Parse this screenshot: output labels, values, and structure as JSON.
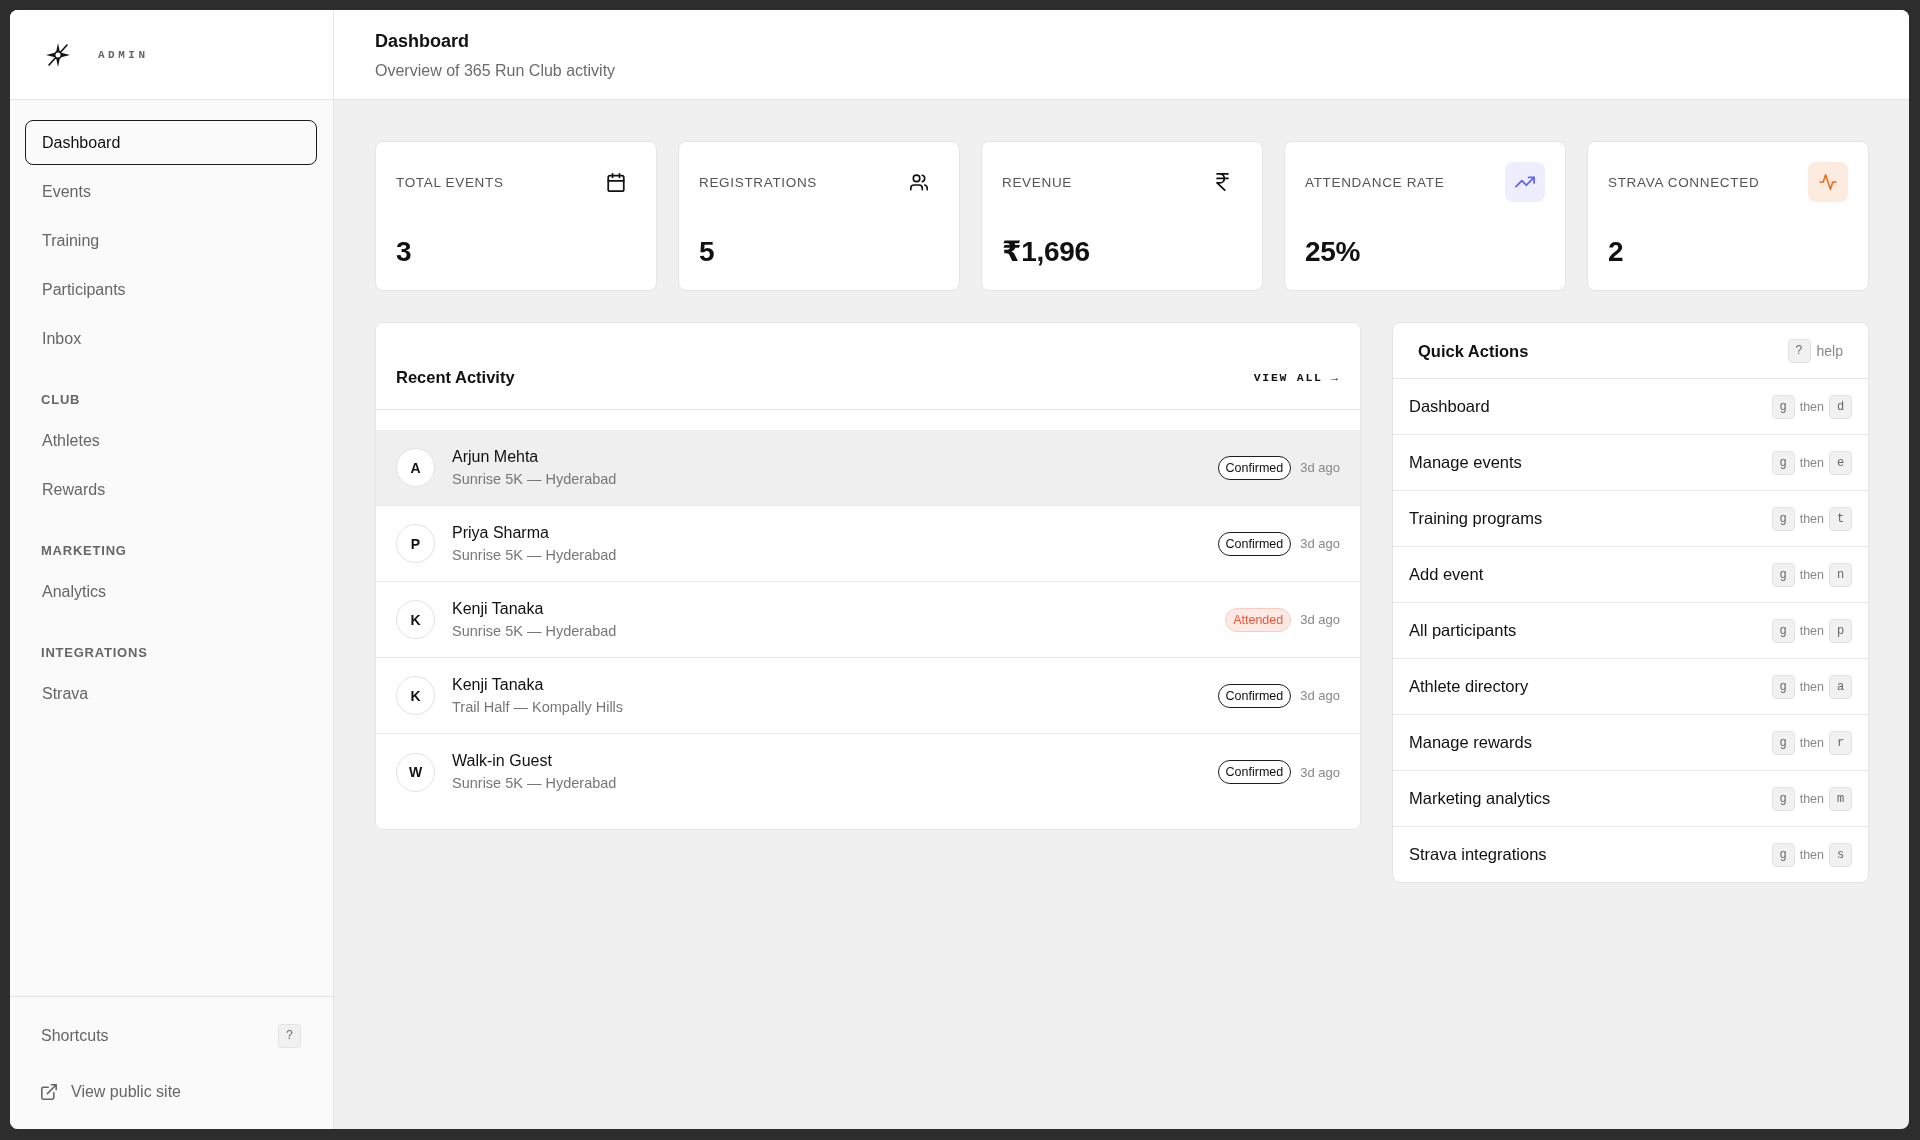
{
  "sidebar": {
    "brand": "ADMIN",
    "sections": [
      {
        "items": [
          {
            "label": "Dashboard",
            "selected": true
          },
          {
            "label": "Events",
            "selected": false
          },
          {
            "label": "Training",
            "selected": false
          },
          {
            "label": "Participants",
            "selected": false
          },
          {
            "label": "Inbox",
            "selected": false
          }
        ]
      },
      {
        "heading": "CLUB",
        "items": [
          {
            "label": "Athletes",
            "selected": false
          },
          {
            "label": "Rewards",
            "selected": false
          }
        ]
      },
      {
        "heading": "MARKETING",
        "items": [
          {
            "label": "Analytics",
            "selected": false
          }
        ]
      },
      {
        "heading": "INTEGRATIONS",
        "items": [
          {
            "label": "Strava",
            "selected": false
          }
        ]
      }
    ],
    "footer": {
      "shortcuts_label": "Shortcuts",
      "shortcuts_key": "?",
      "public_site_link": "View public site"
    }
  },
  "header": {
    "title": "Dashboard",
    "subtitle": "Overview of 365 Run Club activity"
  },
  "stats": [
    {
      "kind": "events",
      "label": "TOTAL EVENTS",
      "value": "3"
    },
    {
      "kind": "registrations",
      "label": "REGISTRATIONS",
      "value": "5"
    },
    {
      "kind": "revenue",
      "label": "REVENUE",
      "value": "₹1,696"
    },
    {
      "kind": "attendance",
      "label": "ATTENDANCE RATE",
      "value": "25%"
    },
    {
      "kind": "strava",
      "label": "STRAVA CONNECTED",
      "value": "2"
    }
  ],
  "recent_activity": {
    "title": "Recent Activity",
    "view_all": "VIEW ALL →",
    "rows": [
      {
        "initial": "A",
        "name": "Arjun Mehta",
        "event": "Sunrise 5K — Hyderabad",
        "status": {
          "label": "Confirmed",
          "kind": "confirmed"
        },
        "time": "3d ago",
        "highlighted": true
      },
      {
        "initial": "P",
        "name": "Priya Sharma",
        "event": "Sunrise 5K — Hyderabad",
        "status": {
          "label": "Confirmed",
          "kind": "confirmed"
        },
        "time": "3d ago",
        "highlighted": false
      },
      {
        "initial": "K",
        "name": "Kenji Tanaka",
        "event": "Sunrise 5K — Hyderabad",
        "status": {
          "label": "Attended",
          "kind": "attended"
        },
        "time": "3d ago",
        "highlighted": false
      },
      {
        "initial": "K",
        "name": "Kenji Tanaka",
        "event": "Trail Half — Kompally Hills",
        "status": {
          "label": "Confirmed",
          "kind": "confirmed"
        },
        "time": "3d ago",
        "highlighted": false
      },
      {
        "initial": "W",
        "name": "Walk-in Guest",
        "event": "Sunrise 5K — Hyderabad",
        "status": {
          "label": "Confirmed",
          "kind": "confirmed"
        },
        "time": "3d ago",
        "highlighted": false
      }
    ]
  },
  "quick_actions": {
    "title": "Quick Actions",
    "help": {
      "key": "?",
      "label": "help"
    },
    "items": [
      {
        "label": "Dashboard",
        "shortcut": {
          "first": "g",
          "joiner": "then",
          "second": "d"
        }
      },
      {
        "label": "Manage events",
        "shortcut": {
          "first": "g",
          "joiner": "then",
          "second": "e"
        }
      },
      {
        "label": "Training programs",
        "shortcut": {
          "first": "g",
          "joiner": "then",
          "second": "t"
        }
      },
      {
        "label": "Add event",
        "shortcut": {
          "first": "g",
          "joiner": "then",
          "second": "n"
        }
      },
      {
        "label": "All participants",
        "shortcut": {
          "first": "g",
          "joiner": "then",
          "second": "p"
        }
      },
      {
        "label": "Athlete directory",
        "shortcut": {
          "first": "g",
          "joiner": "then",
          "second": "a"
        }
      },
      {
        "label": "Manage rewards",
        "shortcut": {
          "first": "g",
          "joiner": "then",
          "second": "r"
        }
      },
      {
        "label": "Marketing analytics",
        "shortcut": {
          "first": "g",
          "joiner": "then",
          "second": "m"
        }
      },
      {
        "label": "Strava integrations",
        "shortcut": {
          "first": "g",
          "joiner": "then",
          "second": "s"
        }
      }
    ]
  }
}
